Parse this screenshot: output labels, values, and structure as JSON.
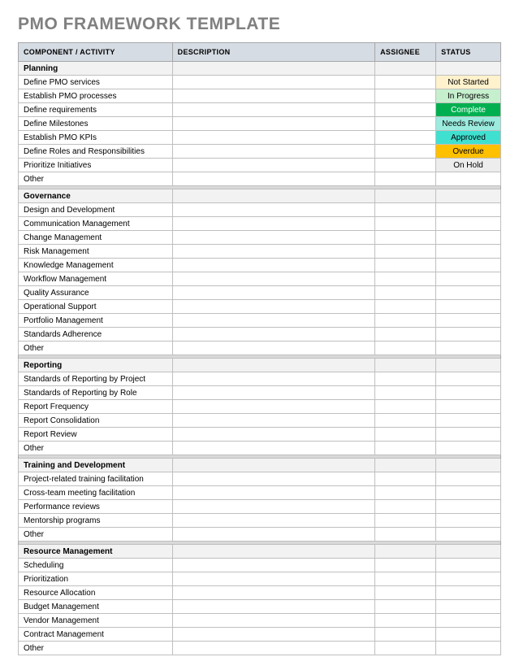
{
  "title": "PMO FRAMEWORK TEMPLATE",
  "headers": {
    "activity": "COMPONENT / ACTIVITY",
    "description": "DESCRIPTION",
    "assignee": "ASSIGNEE",
    "status": "STATUS"
  },
  "status_options": [
    {
      "label": "Not Started",
      "class": "status-not-started"
    },
    {
      "label": "In Progress",
      "class": "status-in-progress"
    },
    {
      "label": "Complete",
      "class": "status-complete"
    },
    {
      "label": "Needs Review",
      "class": "status-needs-review"
    },
    {
      "label": "Approved",
      "class": "status-approved"
    },
    {
      "label": "Overdue",
      "class": "status-overdue"
    },
    {
      "label": "On Hold",
      "class": "status-on-hold"
    }
  ],
  "sections": [
    {
      "name": "Planning",
      "rows": [
        {
          "activity": "Define PMO services",
          "description": "",
          "assignee": "",
          "status_index": 0
        },
        {
          "activity": "Establish PMO processes",
          "description": "",
          "assignee": "",
          "status_index": 1
        },
        {
          "activity": "Define requirements",
          "description": "",
          "assignee": "",
          "status_index": 2
        },
        {
          "activity": "Define Milestones",
          "description": "",
          "assignee": "",
          "status_index": 3
        },
        {
          "activity": "Establish PMO KPIs",
          "description": "",
          "assignee": "",
          "status_index": 4
        },
        {
          "activity": "Define Roles and Responsibilities",
          "description": "",
          "assignee": "",
          "status_index": 5
        },
        {
          "activity": "Prioritize Initiatives",
          "description": "",
          "assignee": "",
          "status_index": 6
        },
        {
          "activity": "Other",
          "description": "",
          "assignee": "",
          "status_index": null
        }
      ]
    },
    {
      "name": "Governance",
      "rows": [
        {
          "activity": "Design and Development",
          "description": "",
          "assignee": "",
          "status_index": null
        },
        {
          "activity": "Communication Management",
          "description": "",
          "assignee": "",
          "status_index": null
        },
        {
          "activity": "Change Management",
          "description": "",
          "assignee": "",
          "status_index": null
        },
        {
          "activity": "Risk Management",
          "description": "",
          "assignee": "",
          "status_index": null
        },
        {
          "activity": "Knowledge Management",
          "description": "",
          "assignee": "",
          "status_index": null
        },
        {
          "activity": "Workflow Management",
          "description": "",
          "assignee": "",
          "status_index": null
        },
        {
          "activity": "Quality Assurance",
          "description": "",
          "assignee": "",
          "status_index": null
        },
        {
          "activity": "Operational Support",
          "description": "",
          "assignee": "",
          "status_index": null
        },
        {
          "activity": "Portfolio Management",
          "description": "",
          "assignee": "",
          "status_index": null
        },
        {
          "activity": "Standards Adherence",
          "description": "",
          "assignee": "",
          "status_index": null
        },
        {
          "activity": "Other",
          "description": "",
          "assignee": "",
          "status_index": null
        }
      ]
    },
    {
      "name": "Reporting",
      "rows": [
        {
          "activity": "Standards of Reporting by Project",
          "description": "",
          "assignee": "",
          "status_index": null
        },
        {
          "activity": "Standards of Reporting by Role",
          "description": "",
          "assignee": "",
          "status_index": null
        },
        {
          "activity": "Report Frequency",
          "description": "",
          "assignee": "",
          "status_index": null
        },
        {
          "activity": "Report Consolidation",
          "description": "",
          "assignee": "",
          "status_index": null
        },
        {
          "activity": "Report Review",
          "description": "",
          "assignee": "",
          "status_index": null
        },
        {
          "activity": "Other",
          "description": "",
          "assignee": "",
          "status_index": null
        }
      ]
    },
    {
      "name": "Training and Development",
      "rows": [
        {
          "activity": "Project-related training facilitation",
          "description": "",
          "assignee": "",
          "status_index": null
        },
        {
          "activity": "Cross-team meeting facilitation",
          "description": "",
          "assignee": "",
          "status_index": null
        },
        {
          "activity": "Performance reviews",
          "description": "",
          "assignee": "",
          "status_index": null
        },
        {
          "activity": "Mentorship programs",
          "description": "",
          "assignee": "",
          "status_index": null
        },
        {
          "activity": "Other",
          "description": "",
          "assignee": "",
          "status_index": null
        }
      ]
    },
    {
      "name": "Resource Management",
      "rows": [
        {
          "activity": "Scheduling",
          "description": "",
          "assignee": "",
          "status_index": null
        },
        {
          "activity": "Prioritization",
          "description": "",
          "assignee": "",
          "status_index": null
        },
        {
          "activity": "Resource Allocation",
          "description": "",
          "assignee": "",
          "status_index": null
        },
        {
          "activity": "Budget Management",
          "description": "",
          "assignee": "",
          "status_index": null
        },
        {
          "activity": "Vendor Management",
          "description": "",
          "assignee": "",
          "status_index": null
        },
        {
          "activity": "Contract Management",
          "description": "",
          "assignee": "",
          "status_index": null
        },
        {
          "activity": "Other",
          "description": "",
          "assignee": "",
          "status_index": null
        }
      ]
    }
  ]
}
